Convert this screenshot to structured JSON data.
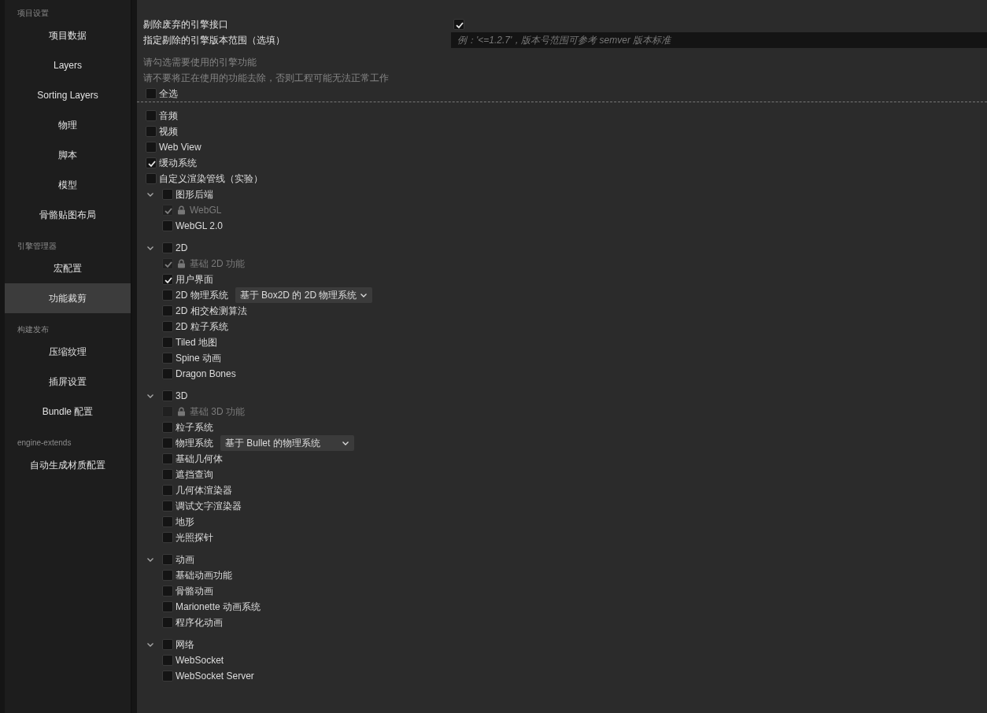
{
  "sidebar": {
    "sections": [
      {
        "title": "项目设置",
        "items": [
          {
            "label": "项目数据",
            "selected": false
          },
          {
            "label": "Layers",
            "selected": false
          },
          {
            "label": "Sorting Layers",
            "selected": false
          },
          {
            "label": "物理",
            "selected": false
          },
          {
            "label": "脚本",
            "selected": false
          },
          {
            "label": "模型",
            "selected": false
          },
          {
            "label": "骨骼贴图布局",
            "selected": false
          }
        ]
      },
      {
        "title": "引擎管理器",
        "items": [
          {
            "label": "宏配置",
            "selected": false
          },
          {
            "label": "功能裁剪",
            "selected": true
          }
        ]
      },
      {
        "title": "构建发布",
        "items": [
          {
            "label": "压缩纹理",
            "selected": false
          },
          {
            "label": "插屏设置",
            "selected": false
          },
          {
            "label": "Bundle 配置",
            "selected": false
          }
        ]
      },
      {
        "title": "engine-extends",
        "items": [
          {
            "label": "自动生成材质配置",
            "selected": false
          }
        ]
      }
    ]
  },
  "settings": [
    {
      "kind": "checkbox",
      "label": "剔除废弃的引擎接口",
      "checked": true
    },
    {
      "kind": "input",
      "label": "指定剔除的引擎版本范围（选填）",
      "placeholder": "例：'<=1.2.7'，版本号范围可参考 semver 版本标准"
    }
  ],
  "hints": [
    "请勾选需要使用的引擎功能",
    "请不要将正在使用的功能去除，否则工程可能无法正常工作"
  ],
  "select_all": {
    "label": "全选",
    "checked": false
  },
  "features": [
    {
      "kind": "item",
      "label": "音频",
      "checked": false
    },
    {
      "kind": "item",
      "label": "视频",
      "checked": false
    },
    {
      "kind": "item",
      "label": "Web View",
      "checked": false
    },
    {
      "kind": "item",
      "label": "缓动系统",
      "checked": true
    },
    {
      "kind": "item",
      "label": "自定义渲染管线（实验）",
      "checked": false
    },
    {
      "kind": "group",
      "label": "图形后端",
      "checked": false,
      "expanded": true,
      "children": [
        {
          "label": "WebGL",
          "checked": true,
          "locked": true
        },
        {
          "label": "WebGL 2.0",
          "checked": false,
          "locked": false
        }
      ]
    },
    {
      "kind": "group",
      "label": "2D",
      "checked": false,
      "expanded": true,
      "children": [
        {
          "label": "基础 2D 功能",
          "checked": true,
          "locked": true
        },
        {
          "label": "用户界面",
          "checked": true,
          "locked": false
        },
        {
          "label": "2D 物理系统",
          "checked": false,
          "locked": false,
          "option": "基于 Box2D 的 2D 物理系统"
        },
        {
          "label": "2D 相交检测算法",
          "checked": false,
          "locked": false
        },
        {
          "label": "2D 粒子系统",
          "checked": false,
          "locked": false
        },
        {
          "label": "Tiled 地图",
          "checked": false,
          "locked": false
        },
        {
          "label": "Spine 动画",
          "checked": false,
          "locked": false
        },
        {
          "label": "Dragon Bones",
          "checked": false,
          "locked": false
        }
      ]
    },
    {
      "kind": "group",
      "label": "3D",
      "checked": false,
      "expanded": true,
      "children": [
        {
          "label": "基础 3D 功能",
          "checked": false,
          "locked": true
        },
        {
          "label": "粒子系统",
          "checked": false,
          "locked": false
        },
        {
          "label": "物理系统",
          "checked": false,
          "locked": false,
          "option": "基于 Bullet 的物理系统"
        },
        {
          "label": "基础几何体",
          "checked": false,
          "locked": false
        },
        {
          "label": "遮挡查询",
          "checked": false,
          "locked": false
        },
        {
          "label": "几何体渲染器",
          "checked": false,
          "locked": false
        },
        {
          "label": "调试文字渲染器",
          "checked": false,
          "locked": false
        },
        {
          "label": "地形",
          "checked": false,
          "locked": false
        },
        {
          "label": "光照探针",
          "checked": false,
          "locked": false
        }
      ]
    },
    {
      "kind": "group",
      "label": "动画",
      "checked": false,
      "expanded": true,
      "children": [
        {
          "label": "基础动画功能",
          "checked": false,
          "locked": false
        },
        {
          "label": "骨骼动画",
          "checked": false,
          "locked": false
        },
        {
          "label": "Marionette 动画系统",
          "checked": false,
          "locked": false
        },
        {
          "label": "程序化动画",
          "checked": false,
          "locked": false
        }
      ]
    },
    {
      "kind": "group",
      "label": "网络",
      "checked": false,
      "expanded": true,
      "children": [
        {
          "label": "WebSocket",
          "checked": false,
          "locked": false
        },
        {
          "label": "WebSocket Server",
          "checked": false,
          "locked": false
        }
      ]
    }
  ]
}
